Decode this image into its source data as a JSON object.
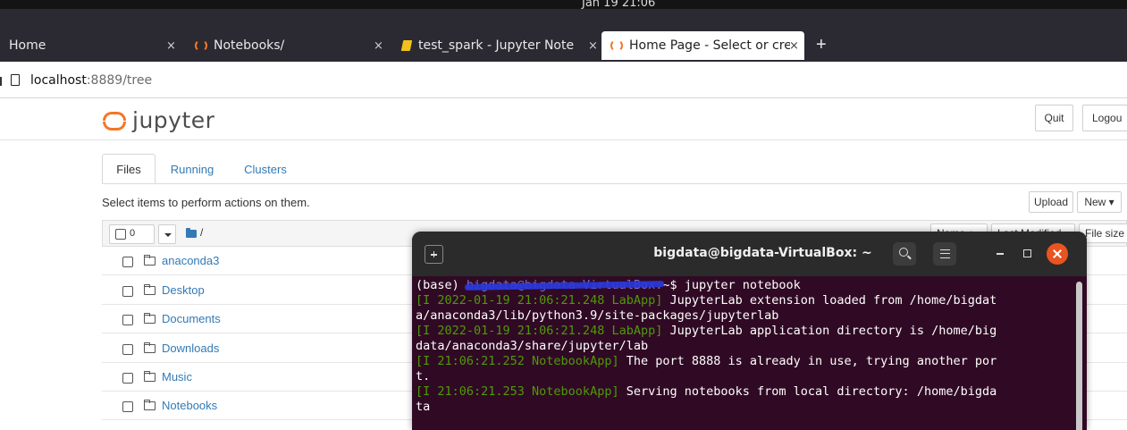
{
  "system": {
    "clock": "Jan 19  21:06"
  },
  "browser": {
    "tabs": [
      {
        "label": "Home",
        "icon": "none"
      },
      {
        "label": "Notebooks/",
        "icon": "jupyter-spinner-icon"
      },
      {
        "label": "test_spark - Jupyter Note",
        "icon": "notebook-icon"
      },
      {
        "label": "Home Page - Select or cre",
        "icon": "jupyter-spinner-icon",
        "active": true
      }
    ],
    "close_glyph": "×",
    "new_tab_glyph": "+",
    "url": {
      "host": "localhost",
      "rest": ":8889/tree"
    }
  },
  "jupyter": {
    "logo_text": "jupyter",
    "quit_label": "Quit",
    "logout_label": "Logou",
    "tabs": [
      "Files",
      "Running",
      "Clusters"
    ],
    "hint": "Select items to perform actions on them.",
    "upload_label": "Upload",
    "new_label": "New ▾",
    "selected_count": "0",
    "path": "/",
    "column_name": "Name ↓",
    "column_modified": "Last Modified",
    "column_size": "File size",
    "files": [
      "anaconda3",
      "Desktop",
      "Documents",
      "Downloads",
      "Music",
      "Notebooks"
    ]
  },
  "terminal": {
    "title": "bigdata@bigdata-VirtualBox: ~",
    "prompt_prefix": "(base) ",
    "prompt_redacted": "bigdata@bigdata-VirtualBox:",
    "prompt_suffix": "~$ jupyter notebook",
    "lines": [
      {
        "tag": "[I 2022-01-19 21:06:21.248 LabApp]",
        "text": " JupyterLab extension loaded from /home/bigdat"
      },
      {
        "tag": "",
        "text": "a/anaconda3/lib/python3.9/site-packages/jupyterlab"
      },
      {
        "tag": "[I 2022-01-19 21:06:21.248 LabApp]",
        "text": " JupyterLab application directory is /home/big"
      },
      {
        "tag": "",
        "text": "data/anaconda3/share/jupyter/lab"
      },
      {
        "tag": "[I 21:06:21.252 NotebookApp]",
        "text": " The port 8888 is already in use, trying another por"
      },
      {
        "tag": "",
        "text": "t."
      },
      {
        "tag": "[I 21:06:21.253 NotebookApp]",
        "text": " Serving notebooks from local directory: /home/bigda"
      },
      {
        "tag": "",
        "text": "ta"
      }
    ]
  },
  "colors": {
    "jupyter_orange": "#f37726",
    "link_blue": "#337ab7",
    "terminal_bg": "#300a24",
    "terminal_green": "#4e9a06",
    "close_orange": "#e95420"
  }
}
